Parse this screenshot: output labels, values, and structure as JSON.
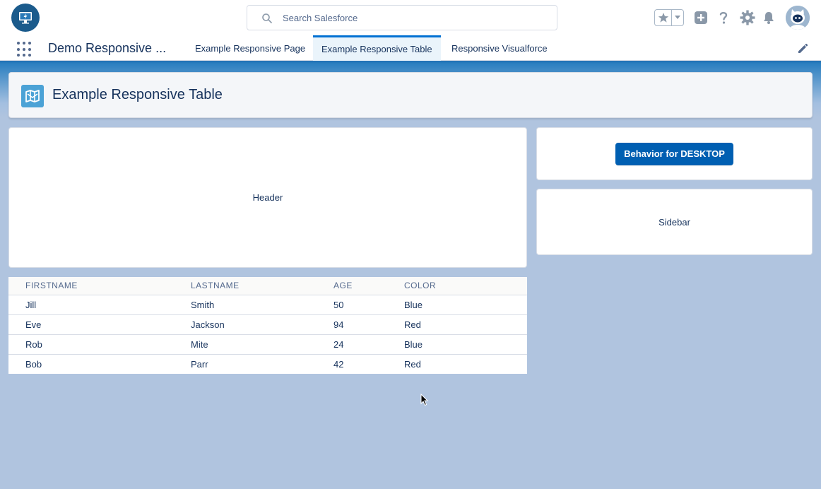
{
  "header": {
    "search_placeholder": "Search Salesforce",
    "app_logo_icon": "lightning-monitor-icon",
    "icons": [
      "star-icon",
      "chevron-down-icon",
      "add-icon",
      "help-icon",
      "gear-icon",
      "bell-icon",
      "avatar"
    ]
  },
  "nav": {
    "app_name": "Demo Responsive ...",
    "tabs": [
      {
        "label": "Example Responsive Page",
        "active": false
      },
      {
        "label": "Example Responsive Table",
        "active": true
      },
      {
        "label": "Responsive Visualforce",
        "active": false
      }
    ]
  },
  "page": {
    "title": "Example Responsive Table",
    "header_card_label": "Header",
    "sidebar_card_label": "Sidebar",
    "behavior_button_label": "Behavior for DESKTOP"
  },
  "table": {
    "columns": [
      "FIRSTNAME",
      "LASTNAME",
      "AGE",
      "COLOR"
    ],
    "rows": [
      [
        "Jill",
        "Smith",
        "50",
        "Blue"
      ],
      [
        "Eve",
        "Jackson",
        "94",
        "Red"
      ],
      [
        "Rob",
        "Mite",
        "24",
        "Blue"
      ],
      [
        "Bob",
        "Parr",
        "42",
        "Red"
      ]
    ]
  },
  "colors": {
    "brand": "#0070d2",
    "button": "#005fb2",
    "background": "#b0c4df",
    "text": "#16325c"
  }
}
